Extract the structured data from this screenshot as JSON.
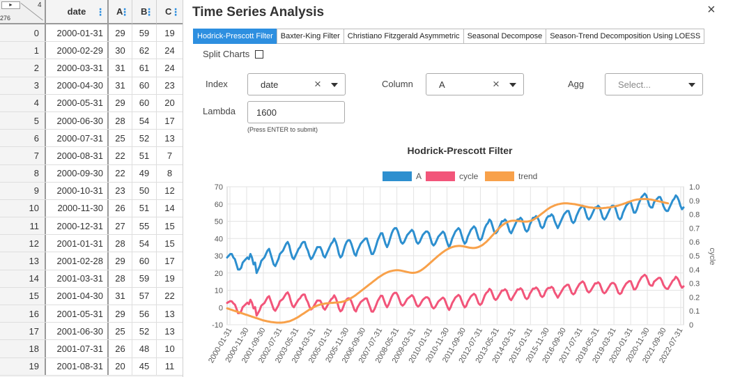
{
  "grid": {
    "corner": {
      "arrow": "►",
      "ncols": "4",
      "nrows": "276"
    },
    "columns": [
      "date",
      "A",
      "B",
      "C"
    ],
    "rows": [
      [
        "0",
        "2000-01-31",
        "29",
        "59",
        "19"
      ],
      [
        "1",
        "2000-02-29",
        "30",
        "62",
        "24"
      ],
      [
        "2",
        "2000-03-31",
        "31",
        "61",
        "24"
      ],
      [
        "3",
        "2000-04-30",
        "31",
        "60",
        "23"
      ],
      [
        "4",
        "2000-05-31",
        "29",
        "60",
        "20"
      ],
      [
        "5",
        "2000-06-30",
        "28",
        "54",
        "17"
      ],
      [
        "6",
        "2000-07-31",
        "25",
        "52",
        "13"
      ],
      [
        "7",
        "2000-08-31",
        "22",
        "51",
        "7"
      ],
      [
        "8",
        "2000-09-30",
        "22",
        "49",
        "8"
      ],
      [
        "9",
        "2000-10-31",
        "23",
        "50",
        "12"
      ],
      [
        "10",
        "2000-11-30",
        "26",
        "51",
        "14"
      ],
      [
        "11",
        "2000-12-31",
        "27",
        "55",
        "15"
      ],
      [
        "12",
        "2001-01-31",
        "28",
        "54",
        "15"
      ],
      [
        "13",
        "2001-02-28",
        "29",
        "60",
        "17"
      ],
      [
        "14",
        "2001-03-31",
        "28",
        "59",
        "19"
      ],
      [
        "15",
        "2001-04-30",
        "31",
        "57",
        "22"
      ],
      [
        "16",
        "2001-05-31",
        "29",
        "56",
        "13"
      ],
      [
        "17",
        "2001-06-30",
        "25",
        "52",
        "13"
      ],
      [
        "18",
        "2001-07-31",
        "26",
        "48",
        "10"
      ],
      [
        "19",
        "2001-08-31",
        "20",
        "45",
        "11"
      ]
    ]
  },
  "panel": {
    "title": "Time Series Analysis",
    "close_icon": "×",
    "tabs": [
      {
        "label": "Hodrick-Prescott Filter",
        "active": true
      },
      {
        "label": "Baxter-King Filter",
        "active": false
      },
      {
        "label": "Christiano Fitzgerald Asymmetric",
        "active": false
      },
      {
        "label": "Seasonal Decompose",
        "active": false
      },
      {
        "label": "Season-Trend Decomposition Using LOESS",
        "active": false
      }
    ],
    "split_charts_label": "Split Charts",
    "index": {
      "label": "Index",
      "value": "date"
    },
    "column": {
      "label": "Column",
      "value": "A"
    },
    "agg": {
      "label": "Agg",
      "placeholder": "Select..."
    },
    "lambda": {
      "label": "Lambda",
      "value": "1600",
      "hint": "(Press ENTER to submit)"
    }
  },
  "colors": {
    "accent": "#2d8fe0",
    "series_a": "#2d8fcf",
    "cycle": "#f2557a",
    "trend": "#f8a14a"
  },
  "chart_data": {
    "type": "line",
    "title": "Hodrick-Prescott Filter",
    "legend": [
      "A",
      "cycle",
      "trend"
    ],
    "legend_position": "top",
    "xlabel": "",
    "ylabel": "",
    "y2label": "cycle",
    "ylim": [
      -10,
      70
    ],
    "y2lim": [
      0,
      1
    ],
    "yticks": [
      "-10",
      "0",
      "10",
      "20",
      "30",
      "40",
      "50",
      "60",
      "70"
    ],
    "y2ticks": [
      "0",
      "0.1",
      "0.2",
      "0.3",
      "0.4",
      "0.5",
      "0.6",
      "0.7",
      "0.8",
      "0.9",
      "1.0"
    ],
    "xticks": [
      "2000-01-31",
      "2000-11-30",
      "2001-09-30",
      "2002-07-31",
      "2003-05-31",
      "2004-03-31",
      "2005-01-31",
      "2005-11-30",
      "2006-09-30",
      "2007-07-31",
      "2008-05-31",
      "2009-03-31",
      "2010-01-31",
      "2010-11-30",
      "2011-09-30",
      "2012-07-31",
      "2013-05-31",
      "2014-03-31",
      "2015-01-31",
      "2015-11-30",
      "2016-09-30",
      "2017-07-31",
      "2018-05-31",
      "2019-03-31",
      "2020-01-31",
      "2020-11-30",
      "2021-09-30",
      "2022-07-31"
    ],
    "grid": true,
    "series": [
      {
        "name": "A",
        "values": [
          29,
          30,
          31,
          31,
          29,
          28,
          25,
          22,
          22,
          23,
          26,
          27,
          28,
          29,
          28,
          31,
          29,
          25,
          26,
          20,
          22,
          24,
          27,
          28,
          29,
          31,
          33,
          34,
          31,
          28,
          25,
          24,
          26,
          28,
          31,
          32,
          33,
          35,
          37,
          38,
          36,
          32,
          29,
          28,
          30,
          32,
          34,
          35,
          37,
          38,
          38,
          35,
          33,
          30,
          28,
          29,
          31,
          33,
          35,
          35,
          35,
          33,
          30,
          29,
          31,
          33,
          35,
          37,
          38,
          40,
          38,
          35,
          31,
          29,
          30,
          33,
          36,
          38,
          39,
          39,
          37,
          34,
          31,
          30,
          33,
          35,
          37,
          38,
          39,
          40,
          40,
          37,
          34,
          31,
          31,
          33,
          36,
          39,
          41,
          43,
          43,
          40,
          37,
          35,
          37,
          40,
          43,
          45,
          46,
          46,
          44,
          41,
          38,
          37,
          38,
          40,
          42,
          43,
          44,
          45,
          44,
          41,
          38,
          37,
          38,
          40,
          42,
          43,
          44,
          44,
          43,
          40,
          37,
          36,
          37,
          39,
          41,
          42,
          43,
          44,
          43,
          40,
          37,
          35,
          37,
          40,
          42,
          44,
          45,
          46,
          45,
          42,
          39,
          37,
          38,
          41,
          43,
          45,
          46,
          47,
          46,
          43,
          40,
          39,
          40,
          43,
          46,
          48,
          49,
          51,
          50,
          47,
          44,
          43,
          44,
          46,
          48,
          50,
          50,
          51,
          50,
          47,
          44,
          43,
          45,
          47,
          49,
          51,
          51,
          52,
          51,
          48,
          45,
          44,
          45,
          48,
          50,
          52,
          52,
          53,
          52,
          50,
          47,
          46,
          47,
          50,
          52,
          53,
          53,
          54,
          53,
          50,
          48,
          46,
          48,
          50,
          52,
          54,
          55,
          56,
          56,
          53,
          50,
          49,
          50,
          53,
          55,
          57,
          58,
          59,
          58,
          55,
          52,
          51,
          52,
          54,
          56,
          58,
          58,
          59,
          58,
          55,
          52,
          51,
          52,
          54,
          56,
          58,
          59,
          59,
          58,
          55,
          52,
          51,
          52,
          55,
          57,
          59,
          60,
          61,
          61,
          58,
          55,
          55,
          57,
          60,
          62,
          64,
          65,
          66,
          65,
          62,
          59,
          58,
          58,
          61,
          62,
          63,
          64,
          64,
          62,
          59,
          57,
          56,
          56,
          58,
          60,
          62,
          63,
          65,
          64,
          62,
          59,
          57,
          58
        ]
      },
      {
        "name": "cycle",
        "values": [
          0.158,
          0.165,
          0.171,
          0.169,
          0.155,
          0.146,
          0.116,
          0.084,
          0.085,
          0.097,
          0.128,
          0.138,
          0.149,
          0.16,
          0.149,
          0.181,
          0.16,
          0.118,
          0.128,
          0.066,
          0.087,
          0.107,
          0.138,
          0.148,
          0.157,
          0.178,
          0.198,
          0.207,
          0.176,
          0.144,
          0.112,
          0.101,
          0.12,
          0.14,
          0.17,
          0.179,
          0.188,
          0.207,
          0.226,
          0.235,
          0.213,
          0.171,
          0.138,
          0.127,
          0.146,
          0.165,
          0.183,
          0.192,
          0.21,
          0.219,
          0.218,
          0.185,
          0.163,
          0.131,
          0.11,
          0.119,
          0.138,
          0.157,
          0.176,
          0.175,
          0.174,
          0.152,
          0.12,
          0.109,
          0.128,
          0.147,
          0.166,
          0.185,
          0.194,
          0.213,
          0.192,
          0.16,
          0.118,
          0.097,
          0.106,
          0.135,
          0.165,
          0.184,
          0.192,
          0.191,
          0.17,
          0.139,
          0.107,
          0.096,
          0.126,
          0.145,
          0.164,
          0.173,
          0.182,
          0.191,
          0.19,
          0.159,
          0.128,
          0.096,
          0.095,
          0.114,
          0.143,
          0.172,
          0.191,
          0.21,
          0.209,
          0.178,
          0.147,
          0.127,
          0.146,
          0.175,
          0.204,
          0.223,
          0.232,
          0.231,
          0.211,
          0.18,
          0.149,
          0.138,
          0.148,
          0.167,
          0.187,
          0.196,
          0.205,
          0.214,
          0.203,
          0.173,
          0.143,
          0.132,
          0.141,
          0.161,
          0.18,
          0.19,
          0.199,
          0.199,
          0.189,
          0.159,
          0.129,
          0.118,
          0.128,
          0.148,
          0.168,
          0.178,
          0.188,
          0.197,
          0.187,
          0.157,
          0.127,
          0.107,
          0.127,
          0.157,
          0.177,
          0.197,
          0.206,
          0.216,
          0.206,
          0.176,
          0.146,
          0.126,
          0.136,
          0.166,
          0.186,
          0.205,
          0.215,
          0.224,
          0.214,
          0.184,
          0.154,
          0.144,
          0.154,
          0.183,
          0.213,
          0.232,
          0.241,
          0.26,
          0.25,
          0.22,
          0.19,
          0.18,
          0.19,
          0.21,
          0.229,
          0.248,
          0.248,
          0.257,
          0.247,
          0.218,
          0.188,
          0.178,
          0.198,
          0.217,
          0.236,
          0.256,
          0.255,
          0.264,
          0.254,
          0.225,
          0.196,
          0.186,
          0.195,
          0.224,
          0.243,
          0.262,
          0.261,
          0.27,
          0.26,
          0.24,
          0.211,
          0.201,
          0.21,
          0.239,
          0.258,
          0.267,
          0.266,
          0.275,
          0.265,
          0.235,
          0.216,
          0.196,
          0.215,
          0.234,
          0.253,
          0.272,
          0.281,
          0.29,
          0.289,
          0.259,
          0.23,
          0.22,
          0.229,
          0.258,
          0.277,
          0.296,
          0.305,
          0.314,
          0.303,
          0.273,
          0.244,
          0.234,
          0.243,
          0.262,
          0.281,
          0.3,
          0.299,
          0.308,
          0.297,
          0.268,
          0.238,
          0.228,
          0.237,
          0.256,
          0.275,
          0.294,
          0.303,
          0.302,
          0.291,
          0.262,
          0.232,
          0.222,
          0.231,
          0.26,
          0.279,
          0.298,
          0.307,
          0.316,
          0.315,
          0.286,
          0.256,
          0.257,
          0.276,
          0.305,
          0.324,
          0.344,
          0.353,
          0.362,
          0.352,
          0.323,
          0.293,
          0.284,
          0.283,
          0.312,
          0.321,
          0.331,
          0.34,
          0.34,
          0.32,
          0.29,
          0.271,
          0.261,
          0.26,
          0.28,
          0.299,
          0.319,
          0.328,
          0.348,
          0.338,
          0.318,
          0.288,
          0.268,
          0.278
        ]
      },
      {
        "name": "trend",
        "values": [
          -0.5,
          -0.8,
          -1.1,
          -1.4,
          -1.7,
          -2.0,
          -2.3,
          -2.6,
          -2.9,
          -3.2,
          -3.5,
          -3.8,
          -4.1,
          -4.4,
          -4.7,
          -5.0,
          -5.3,
          -5.6,
          -5.9,
          -6.2,
          -6.5,
          -6.8,
          -7.1,
          -7.4,
          -7.6,
          -7.8,
          -8.0,
          -8.2,
          -8.4,
          -8.5,
          -8.6,
          -8.7,
          -8.8,
          -8.8,
          -8.8,
          -8.8,
          -8.7,
          -8.6,
          -8.4,
          -8.2,
          -8.0,
          -7.7,
          -7.3,
          -6.9,
          -6.4,
          -5.9,
          -5.4,
          -4.8,
          -4.2,
          -3.6,
          -3.0,
          -2.4,
          -1.8,
          -1.2,
          -0.7,
          -0.2,
          0.3,
          0.7,
          1.1,
          1.4,
          1.7,
          1.9,
          2.1,
          2.3,
          2.4,
          2.5,
          2.6,
          2.7,
          2.7,
          2.8,
          2.8,
          2.9,
          3.0,
          3.1,
          3.3,
          3.5,
          3.8,
          4.1,
          4.5,
          5.0,
          5.5,
          6.1,
          6.7,
          7.3,
          8.0,
          8.7,
          9.4,
          10.1,
          10.8,
          11.5,
          12.2,
          12.9,
          13.6,
          14.3,
          15.0,
          15.7,
          16.4,
          17.1,
          17.7,
          18.3,
          18.9,
          19.4,
          19.9,
          20.3,
          20.7,
          21.0,
          21.2,
          21.4,
          21.5,
          21.6,
          21.6,
          21.5,
          21.4,
          21.2,
          21.0,
          20.8,
          20.6,
          20.4,
          20.2,
          20.1,
          20.1,
          20.2,
          20.4,
          20.7,
          21.1,
          21.6,
          22.2,
          22.9,
          23.6,
          24.4,
          25.2,
          26.0,
          26.8,
          27.6,
          28.4,
          29.2,
          30.0,
          30.7,
          31.4,
          32.1,
          32.7,
          33.3,
          33.8,
          34.3,
          34.7,
          35.0,
          35.3,
          35.5,
          35.6,
          35.7,
          35.7,
          35.6,
          35.5,
          35.3,
          35.1,
          34.9,
          34.7,
          34.6,
          34.5,
          34.5,
          34.6,
          34.8,
          35.1,
          35.5,
          36.0,
          36.6,
          37.3,
          38.1,
          39.0,
          39.9,
          40.9,
          41.9,
          42.9,
          43.9,
          44.9,
          45.8,
          46.7,
          47.5,
          48.2,
          48.8,
          49.3,
          49.7,
          50.0,
          50.2,
          50.3,
          50.3,
          50.3,
          50.2,
          50.1,
          50.0,
          49.9,
          49.8,
          49.8,
          49.8,
          49.9,
          50.1,
          50.4,
          50.8,
          51.3,
          51.9,
          52.5,
          53.2,
          53.9,
          54.6,
          55.3,
          56.0,
          56.7,
          57.3,
          57.9,
          58.4,
          58.8,
          59.2,
          59.5,
          59.8,
          60.0,
          60.2,
          60.3,
          60.4,
          60.4,
          60.4,
          60.3,
          60.2,
          60.1,
          60.0,
          59.9,
          59.7,
          59.5,
          59.3,
          59.1,
          58.9,
          58.7,
          58.5,
          58.3,
          58.1,
          58.0,
          57.9,
          57.8,
          57.7,
          57.6,
          57.6,
          57.6,
          57.6,
          57.6,
          57.7,
          57.8,
          57.9,
          58.0,
          58.1,
          58.3,
          58.5,
          58.7,
          58.9,
          59.1,
          59.4,
          59.7,
          60.0,
          60.3,
          60.6,
          61.0,
          61.3,
          61.6,
          61.9,
          62.2,
          62.4,
          62.6,
          62.7,
          62.8,
          62.9,
          62.9,
          62.9,
          62.9,
          62.8,
          62.7,
          62.6,
          62.4,
          62.2,
          62.0,
          61.8,
          61.6,
          61.4,
          61.2,
          61.0,
          60.8,
          60.6,
          60.4
        ]
      }
    ]
  }
}
